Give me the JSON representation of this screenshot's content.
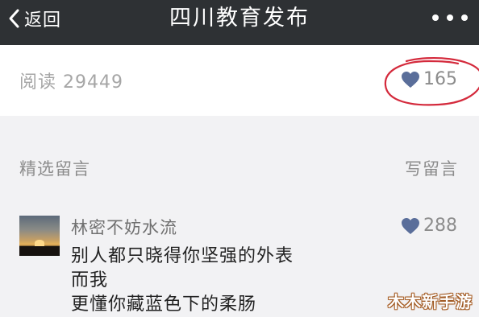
{
  "navbar": {
    "back_label": "返回",
    "title": "四川教育发布",
    "more_icon": "more-dots-icon"
  },
  "article": {
    "read_count_label": "阅读 29449",
    "like_count": "165"
  },
  "comments": {
    "section_label": "精选留言",
    "write_label": "写留言",
    "items": [
      {
        "nickname": "林密不妨水流",
        "likes": "288",
        "lines": [
          "别人都只晓得你坚强的外表",
          "而我",
          "更懂你藏蓝色下的柔肠"
        ]
      }
    ]
  },
  "watermark": "木木新手游",
  "colors": {
    "navbar_bg": "#2e3134",
    "heart": "#5a6e9a",
    "annotation_circle": "#d42a3c"
  }
}
